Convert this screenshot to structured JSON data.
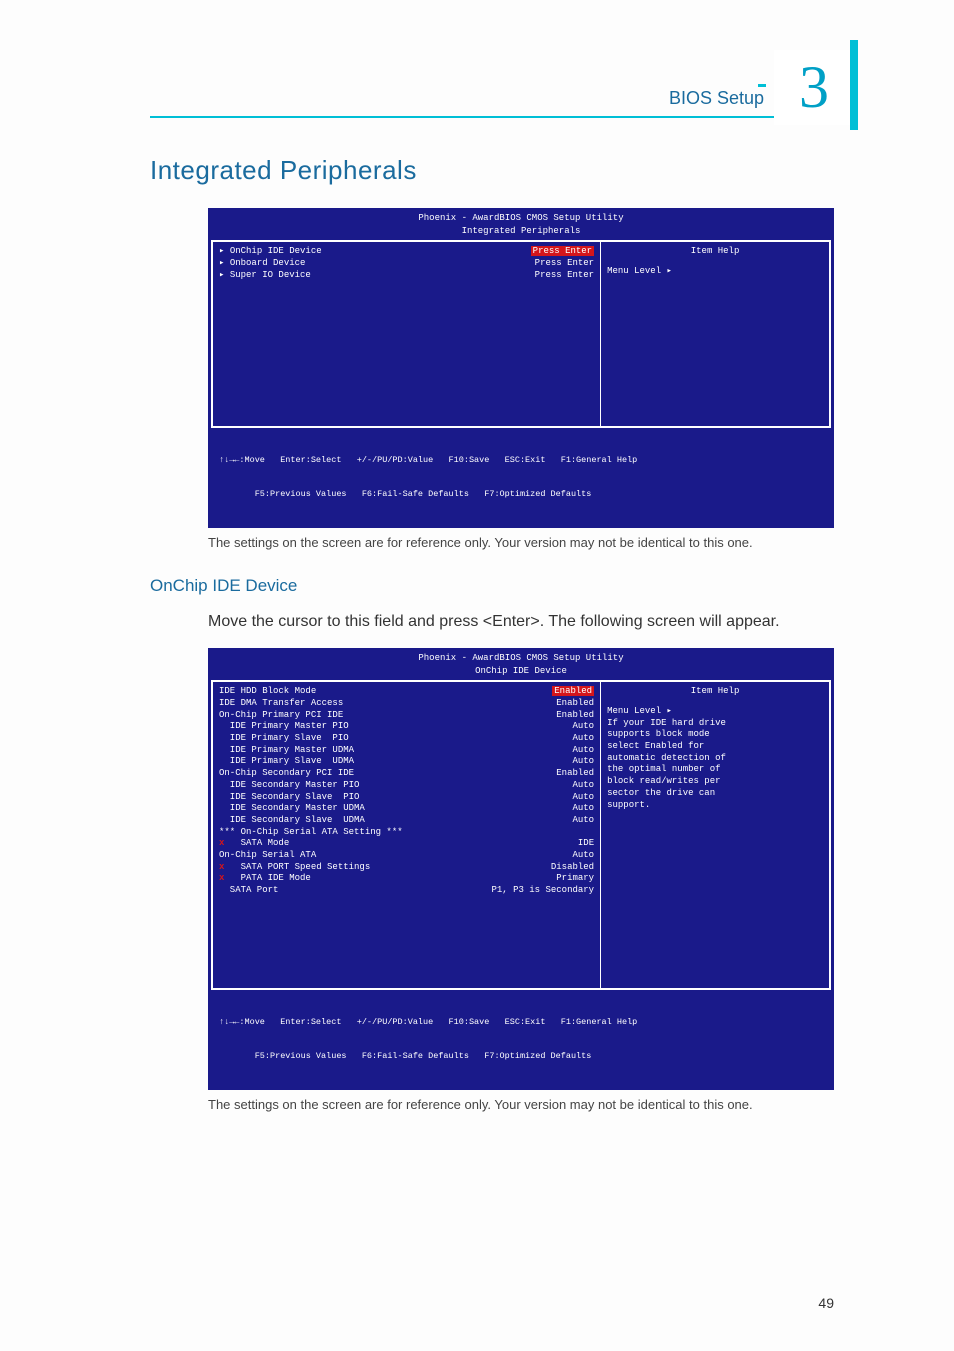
{
  "header": {
    "chapter_number": "3",
    "chapter_label": "BIOS Setup"
  },
  "h1": "Integrated Peripherals",
  "h2": "OnChip IDE Device",
  "caption1": "The settings on the screen are for reference only. Your version may not be identical to this one.",
  "body1": "Move the cursor to this field and press <Enter>. The following screen will appear.",
  "caption2": "The settings on the screen are for reference only. Your version may not be identical to this one.",
  "page_number": "49",
  "bios1": {
    "title": "Phoenix - AwardBIOS CMOS Setup Utility",
    "subtitle": "Integrated Peripherals",
    "rows": [
      {
        "tri": true,
        "label": "OnChip IDE Device",
        "val": "Press Enter",
        "selected": true
      },
      {
        "tri": true,
        "label": "Onboard Device",
        "val": "Press Enter"
      },
      {
        "tri": true,
        "label": "Super IO Device",
        "val": "Press Enter"
      }
    ],
    "help_title": "Item Help",
    "help_lines": [
      "Menu Level   ▸"
    ],
    "footer_l1": "↑↓→←:Move   Enter:Select   +/-/PU/PD:Value   F10:Save   ESC:Exit   F1:General Help",
    "footer_l2": "       F5:Previous Values   F6:Fail-Safe Defaults   F7:Optimized Defaults"
  },
  "bios2": {
    "title": "Phoenix - AwardBIOS CMOS Setup Utility",
    "subtitle": "OnChip IDE Device",
    "rows": [
      {
        "label": "IDE HDD Block Mode",
        "val": "Enabled",
        "selected": true
      },
      {
        "label": "IDE DMA Transfer Access",
        "val": "Enabled"
      },
      {
        "label": "On-Chip Primary PCI IDE",
        "val": "Enabled"
      },
      {
        "label": "  IDE Primary Master PIO",
        "val": "Auto"
      },
      {
        "label": "  IDE Primary Slave  PIO",
        "val": "Auto"
      },
      {
        "label": "  IDE Primary Master UDMA",
        "val": "Auto"
      },
      {
        "label": "  IDE Primary Slave  UDMA",
        "val": "Auto"
      },
      {
        "label": "On-Chip Secondary PCI IDE",
        "val": "Enabled"
      },
      {
        "label": "  IDE Secondary Master PIO",
        "val": "Auto"
      },
      {
        "label": "  IDE Secondary Slave  PIO",
        "val": "Auto"
      },
      {
        "label": "  IDE Secondary Master UDMA",
        "val": "Auto"
      },
      {
        "label": "  IDE Secondary Slave  UDMA",
        "val": "Auto"
      },
      {
        "label": "",
        "val": ""
      },
      {
        "label": "*** On-Chip Serial ATA Setting ***",
        "val": ""
      },
      {
        "label": "  SATA Mode",
        "val": "IDE",
        "x": true
      },
      {
        "label": "On-Chip Serial ATA",
        "val": "Auto"
      },
      {
        "label": "  SATA PORT Speed Settings",
        "val": "Disabled",
        "x": true
      },
      {
        "label": "  PATA IDE Mode",
        "val": "Primary",
        "x": true
      },
      {
        "label": "  SATA Port",
        "val": "P1, P3 is Secondary"
      }
    ],
    "help_title": "Item Help",
    "help_lines": [
      "Menu Level   ▸",
      "",
      "If your IDE hard drive",
      "supports block mode",
      "select Enabled for",
      "automatic detection of",
      "the optimal number of",
      "block read/writes per",
      "sector the drive can",
      "support."
    ],
    "footer_l1": "↑↓→←:Move   Enter:Select   +/-/PU/PD:Value   F10:Save   ESC:Exit   F1:General Help",
    "footer_l2": "       F5:Previous Values   F6:Fail-Safe Defaults   F7:Optimized Defaults"
  }
}
